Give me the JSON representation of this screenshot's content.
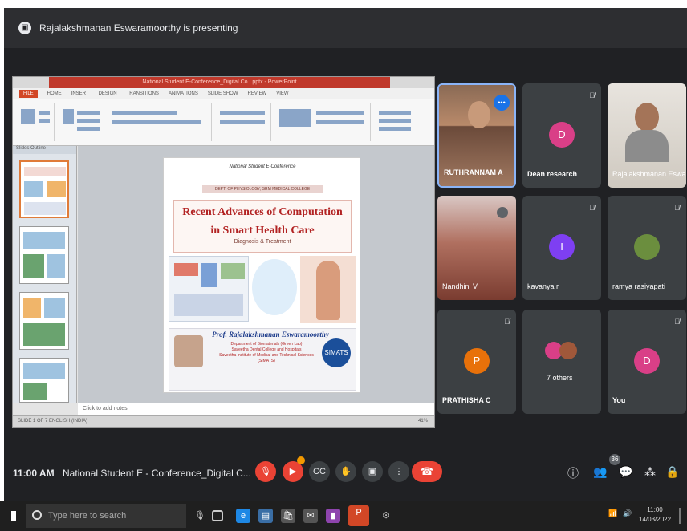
{
  "banner": {
    "text": "Rajalakshmanan Eswaramoorthy is presenting"
  },
  "ppt": {
    "window_title": "National Student E-Conference_Digital Co...pptx - PowerPoint",
    "menu": [
      "FILE",
      "HOME",
      "INSERT",
      "DESIGN",
      "TRANSITIONS",
      "ANIMATIONS",
      "SLIDE SHOW",
      "REVIEW",
      "VIEW"
    ],
    "thumb_tabs": "Slides  Outline",
    "notes_placeholder": "Click to add notes",
    "status_left": "SLIDE 1 OF 7    ENGLISH (INDIA)",
    "zoom": "41%"
  },
  "slide": {
    "conference": "National Student E-Conference",
    "organizer": "DEPT. OF PHYSIOLOGY, SRM MEDICAL COLLEGE",
    "title_line1": "Recent Advances of Computation",
    "title_line2": "in Smart Health Care",
    "subtitle": "Diagnosis & Treatment",
    "speaker": "Prof. Rajalakshmanan Eswaramoorthy",
    "dept_lines": [
      "Department of Biomaterials (Green Lab)",
      "Saveetha Dental College and Hospitals",
      "Saveetha Institute of Medical and Technical Sciences",
      "(SIMATS)"
    ],
    "logo": "SIMATS"
  },
  "participants": [
    {
      "name": "RUTHRANNAM A",
      "kind": "photo",
      "mic_muted": false,
      "speaking": true
    },
    {
      "name": "Dean research",
      "kind": "avatar",
      "initial": "D",
      "color": "#d93f87",
      "mic_muted": true
    },
    {
      "name": "Rajalakshmanan Eswaramoorthy",
      "kind": "photo",
      "mic_muted": false
    },
    {
      "name": "Nandhini V",
      "kind": "photo",
      "mic_muted": false
    },
    {
      "name": "kavanya r",
      "kind": "avatar",
      "initial": "I",
      "color": "#7e3ff2",
      "mic_muted": true
    },
    {
      "name": "ramya rasiyapati",
      "kind": "photo",
      "mic_muted": true
    },
    {
      "name": "PRATHISHA C",
      "kind": "avatar",
      "initial": "P",
      "color": "#e8710a",
      "mic_muted": true
    },
    {
      "name": "7 others",
      "kind": "group",
      "mic_muted": false
    },
    {
      "name": "You",
      "kind": "avatar",
      "initial": "D",
      "color": "#d93f87",
      "mic_muted": true
    }
  ],
  "callbar": {
    "time": "11:00 AM",
    "meeting_name": "National Student E - Conference_Digital C...",
    "participant_count": "36"
  },
  "taskbar": {
    "search_placeholder": "Type here to search",
    "clock_time": "11:00",
    "clock_date": "14/03/2022"
  },
  "icons": {
    "banner": "present-icon",
    "controls": [
      "mic-off-icon",
      "camera-off-icon",
      "captions-icon",
      "raise-hand-icon",
      "present-screen-icon",
      "more-options-icon",
      "end-call-icon"
    ],
    "right": [
      "info-icon",
      "people-icon",
      "chat-icon",
      "activities-icon",
      "host-controls-icon"
    ]
  },
  "colors": {
    "end_call": "#ea4335",
    "meet_bg": "#202124",
    "tile_bg": "#3c4043"
  }
}
